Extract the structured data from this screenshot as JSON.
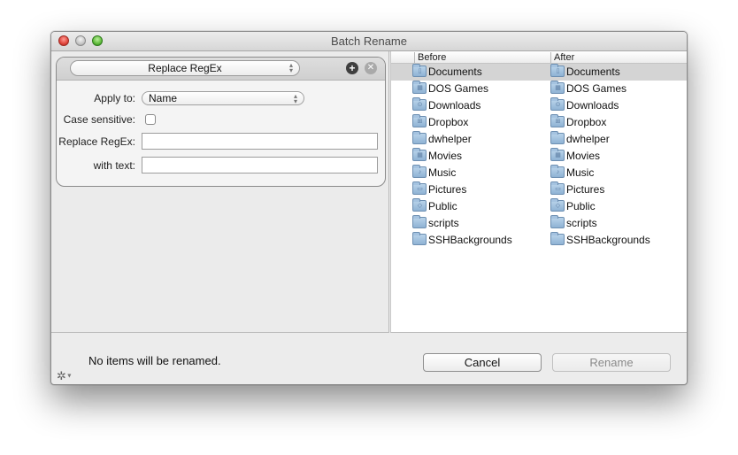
{
  "window": {
    "title": "Batch Rename",
    "traffic_lights": [
      "close",
      "minimize",
      "zoom"
    ]
  },
  "rule": {
    "type_selected": "Replace RegEx",
    "add_icon": "plus-circle-icon",
    "remove_icon": "x-circle-icon",
    "fields": {
      "apply_to_label": "Apply to:",
      "apply_to_value": "Name",
      "case_sensitive_label": "Case sensitive:",
      "case_sensitive_checked": false,
      "replace_regex_label": "Replace RegEx:",
      "replace_regex_value": "",
      "with_text_label": "with text:",
      "with_text_value": ""
    }
  },
  "table": {
    "columns": [
      "Before",
      "After"
    ],
    "rows": [
      {
        "before": "Documents",
        "after": "Documents",
        "icon": "documents-folder-icon",
        "glyph": "▯",
        "selected": true
      },
      {
        "before": "DOS Games",
        "after": "DOS Games",
        "icon": "applications-folder-icon",
        "glyph": "▦",
        "selected": false
      },
      {
        "before": "Downloads",
        "after": "Downloads",
        "icon": "downloads-folder-icon",
        "glyph": "⊙",
        "selected": false
      },
      {
        "before": "Dropbox",
        "after": "Dropbox",
        "icon": "dropbox-folder-icon",
        "glyph": "⊞",
        "selected": false
      },
      {
        "before": "dwhelper",
        "after": "dwhelper",
        "icon": "folder-icon",
        "glyph": "",
        "selected": false
      },
      {
        "before": "Movies",
        "after": "Movies",
        "icon": "movies-folder-icon",
        "glyph": "▦",
        "selected": false
      },
      {
        "before": "Music",
        "after": "Music",
        "icon": "music-folder-icon",
        "glyph": "♪",
        "selected": false
      },
      {
        "before": "Pictures",
        "after": "Pictures",
        "icon": "pictures-folder-icon",
        "glyph": "▭",
        "selected": false
      },
      {
        "before": "Public",
        "after": "Public",
        "icon": "public-folder-icon",
        "glyph": "◇",
        "selected": false
      },
      {
        "before": "scripts",
        "after": "scripts",
        "icon": "folder-icon",
        "glyph": "",
        "selected": false
      },
      {
        "before": "SSHBackgrounds",
        "after": "SSHBackgrounds",
        "icon": "folder-icon",
        "glyph": "",
        "selected": false
      }
    ]
  },
  "footer": {
    "status": "No items will be renamed.",
    "gear_icon": "gear-icon",
    "cancel_label": "Cancel",
    "rename_label": "Rename",
    "rename_enabled": false
  }
}
